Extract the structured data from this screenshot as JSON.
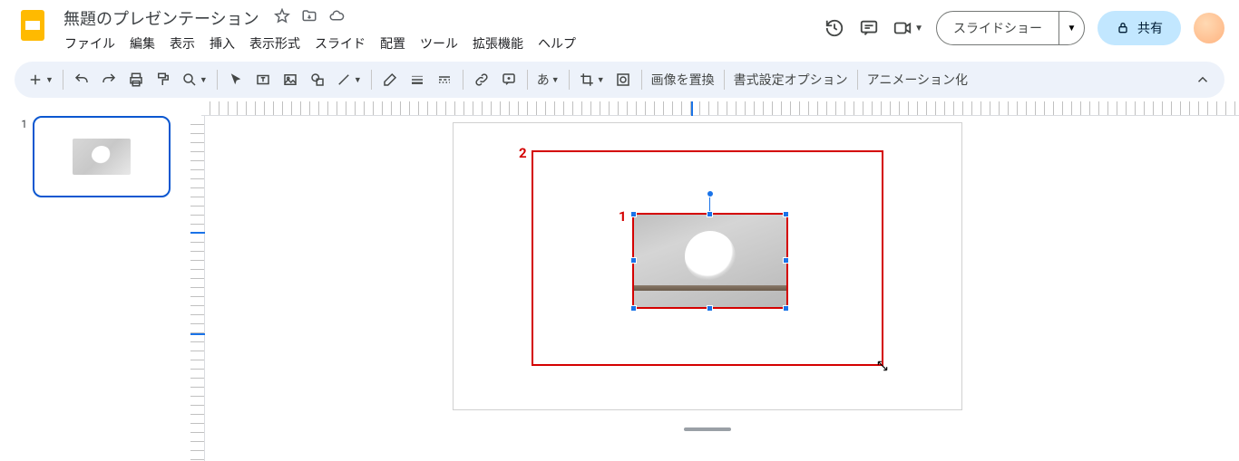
{
  "header": {
    "title": "無題のプレゼンテーション",
    "menus": [
      "ファイル",
      "編集",
      "表示",
      "挿入",
      "表示形式",
      "スライド",
      "配置",
      "ツール",
      "拡張機能",
      "ヘルプ"
    ],
    "slideshow": "スライドショー",
    "share": "共有"
  },
  "toolbar": {
    "replace_image": "画像を置換",
    "format_options": "書式設定オプション",
    "animation": "アニメーション化",
    "text_dir": "あ"
  },
  "sidebar": {
    "slide_number": "1"
  },
  "annotations": {
    "label1": "1",
    "label2": "2"
  }
}
